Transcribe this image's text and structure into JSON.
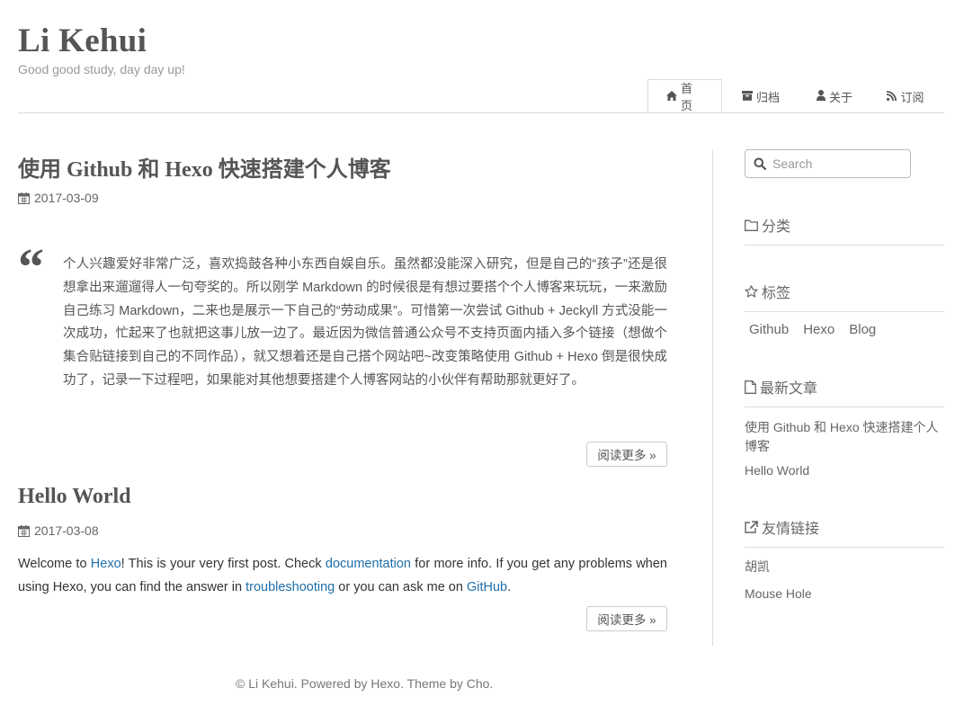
{
  "site": {
    "title": "Li Kehui",
    "subtitle": "Good good study, day day up!"
  },
  "nav": [
    {
      "label": "首页",
      "icon": "home-icon"
    },
    {
      "label": "归档",
      "icon": "archive-icon"
    },
    {
      "label": "关于",
      "icon": "user-icon"
    },
    {
      "label": "订阅",
      "icon": "rss-icon"
    }
  ],
  "posts": [
    {
      "title": "使用 Github 和 Hexo 快速搭建个人博客",
      "date": "2017-03-09",
      "excerpt": "个人兴趣爱好非常广泛，喜欢捣鼓各种小东西自娱自乐。虽然都没能深入研究，但是自己的“孩子”还是很想拿出来遛遛得人一句夸奖的。所以刚学 Markdown 的时候很是有想过要搭个个人博客来玩玩，一来激励自己练习 Markdown，二来也是展示一下自己的“劳动成果”。可惜第一次尝试 Github + Jeckyll 方式没能一次成功，忙起来了也就把这事儿放一边了。最近因为微信普通公众号不支持页面内插入多个链接（想做个集合贴链接到自己的不同作品），就又想着还是自己搭个网站吧~改变策略使用 Github + Hexo 倒是很快成功了，记录一下过程吧，如果能对其他想要搭建个人博客网站的小伙伴有帮助那就更好了。",
      "more": "阅读更多 »"
    },
    {
      "title": "Hello World",
      "date": "2017-03-08",
      "body": {
        "t1": "Welcome to ",
        "l1": "Hexo",
        "t2": "! This is your very first post. Check ",
        "l2": "documentation",
        "t3": " for more info. If you get any problems when using Hexo, you can find the answer in ",
        "l3": "troubleshooting",
        "t4": " or you can ask me on ",
        "l4": "GitHub",
        "t5": "."
      },
      "more": "阅读更多 »"
    }
  ],
  "sidebar": {
    "search_placeholder": "Search",
    "categories_title": "分类",
    "tags_title": "标签",
    "tags": [
      "Github",
      "Hexo",
      "Blog"
    ],
    "recent_title": "最新文章",
    "recent": [
      "使用 Github 和 Hexo 快速搭建个人博客",
      "Hello World"
    ],
    "links_title": "友情链接",
    "links": [
      "胡凯",
      "Mouse Hole"
    ]
  },
  "footer": "© Li Kehui. Powered by Hexo. Theme by Cho.",
  "colors": {
    "link": "#1f6fa8",
    "text": "#555555",
    "border": "#dddddd"
  }
}
